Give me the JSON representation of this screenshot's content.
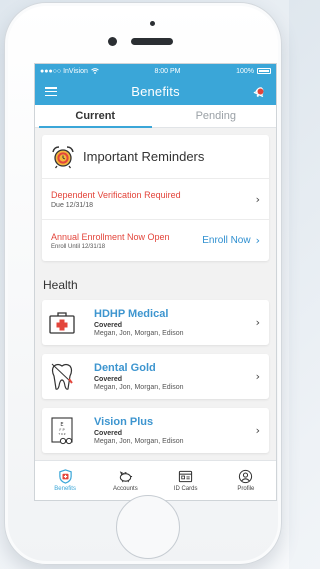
{
  "status_bar": {
    "carrier": "●●●○○ InVision",
    "time": "8:00 PM",
    "battery": "100%"
  },
  "header": {
    "title": "Benefits",
    "menu_icon": "hamburger-icon",
    "notification_icon": "bell-icon"
  },
  "tabs": [
    {
      "label": "Current",
      "active": true
    },
    {
      "label": "Pending",
      "active": false
    }
  ],
  "reminders": {
    "title": "Important Reminders",
    "icon": "alarm-clock-icon",
    "items": [
      {
        "title": "Dependent Verification Required",
        "subtitle": "Due 12/31/18"
      },
      {
        "title": "Annual Enrollment Now Open",
        "subtitle": "Enroll Until 12/31/18",
        "action": "Enroll Now"
      }
    ]
  },
  "health": {
    "title": "Health",
    "plans": [
      {
        "name": "HDHP Medical",
        "status": "Covered",
        "members": "Megan, Jon, Morgan, Edison",
        "icon": "medical-kit-icon"
      },
      {
        "name": "Dental Gold",
        "status": "Covered",
        "members": "Megan, Jon, Morgan, Edison",
        "icon": "tooth-icon"
      },
      {
        "name": "Vision Plus",
        "status": "Covered",
        "members": "Megan, Jon, Morgan, Edison",
        "icon": "eye-chart-icon"
      }
    ]
  },
  "bottom_nav": [
    {
      "label": "Benefits",
      "icon": "shield-icon",
      "active": true
    },
    {
      "label": "Accounts",
      "icon": "piggy-bank-icon",
      "active": false
    },
    {
      "label": "ID Cards",
      "icon": "id-card-icon",
      "active": false
    },
    {
      "label": "Profile",
      "icon": "profile-icon",
      "active": false
    }
  ],
  "colors": {
    "accent": "#3aa6d8",
    "alert": "#e3453b",
    "link": "#2e8fd0"
  }
}
